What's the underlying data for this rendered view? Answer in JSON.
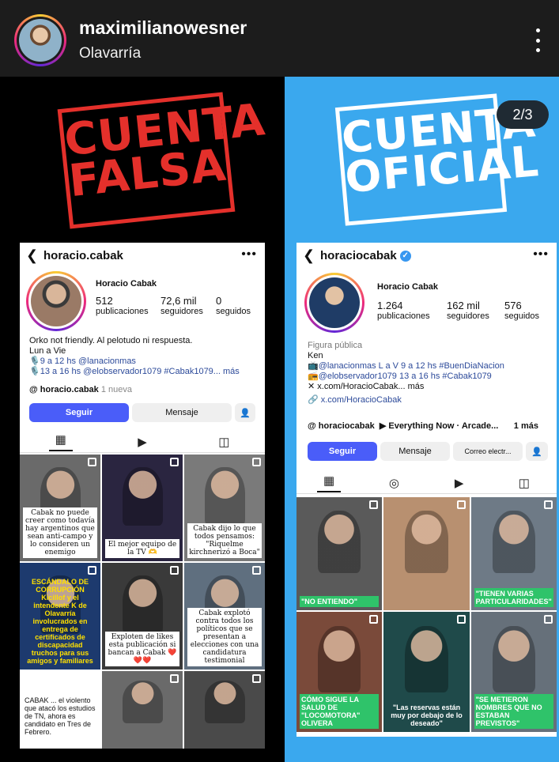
{
  "header": {
    "username": "maximilianowesner",
    "location": "Olavarría"
  },
  "left": {
    "stamp": [
      "CUENTA",
      "FALSA"
    ],
    "profile": {
      "handle": "horacio.cabak",
      "full_name": "Horacio Cabak",
      "stats": [
        {
          "num": "512",
          "label": "publicaciones"
        },
        {
          "num": "72,6 mil",
          "label": "seguidores"
        },
        {
          "num": "0",
          "label": "seguidos"
        }
      ],
      "bio_lines": [
        "Orko not friendly. Al pelotudo ni respuesta.",
        "Lun a Vie",
        "🎙️9 a 12 hs @lanacionmas",
        "🎙️13 a 16 hs @elobservador1079 #Cabak1079... más"
      ],
      "threads_line": "horacio.cabak",
      "threads_badge": "1 nueva",
      "follow_label": "Seguir",
      "message_label": "Mensaje"
    },
    "posts": [
      {
        "caption": "Cabak no puede creer como todavía hay argentinos que sean anti-campo y lo consideren un enemigo",
        "style": "white",
        "bg": "#6a6a6a"
      },
      {
        "caption": "El mejor equipo de la TV 🫶",
        "style": "white",
        "bg": "#2a2540"
      },
      {
        "caption": "Cabak dijo lo que todos pensamos: \"Riquelme kirchnerizó a Boca\"",
        "style": "white",
        "bg": "#7a7a7a"
      },
      {
        "caption": "ESCÁNDALO DE CORRUPCIÓN Kicillof y el intendente K de Olavarría involucrados en entrega de certificados de discapacidad truchos para sus amigos y familiares",
        "style": "yellow",
        "bg": "#1d3a6e"
      },
      {
        "caption": "Exploten de likes esta publicación si bancan a Cabak ❤️❤️❤️",
        "style": "white",
        "bg": "#3a3a3a"
      },
      {
        "caption": "Cabak explotó contra todos los políticos que se presentan a elecciones con una candidatura testimonial",
        "style": "white",
        "bg": "#5f6f7f"
      },
      {
        "caption": "CABAK ... el violento que atacó los estudios de TN, ahora es candidato en Tres de Febrero.",
        "style": "tweet",
        "bg": "#ffffff"
      },
      {
        "caption": "",
        "style": "none",
        "bg": "#6a6a6a"
      },
      {
        "caption": "",
        "style": "none",
        "bg": "#4a4a4a"
      }
    ]
  },
  "right": {
    "stamp": [
      "CUENTA",
      "OFICIAL"
    ],
    "page_indicator": "2/3",
    "profile": {
      "handle": "horaciocabak",
      "full_name": "Horacio Cabak",
      "stats": [
        {
          "num": "1.264",
          "label": "publicaciones"
        },
        {
          "num": "162 mil",
          "label": "seguidores"
        },
        {
          "num": "576",
          "label": "seguidos"
        }
      ],
      "category": "Figura pública",
      "bio_lines": [
        "Ken",
        "📺@lanacionmas L a V 9 a 12 hs #BuenDiaNacion",
        "📻@elobservador1079 13 a 16 hs #Cabak1079",
        "✕ x.com/HoracioCabak... más",
        "🔗 x.com/HoracioCabak"
      ],
      "threads_line": "horaciocabak",
      "music": "Everything Now · Arcade...",
      "more": "1 más",
      "follow_label": "Seguir",
      "message_label": "Mensaje",
      "email_label": "Correo electr..."
    },
    "posts": [
      {
        "caption": "\"NO ENTIENDO\"",
        "style": "green",
        "bg": "#5a5a5a"
      },
      {
        "caption": "",
        "style": "none",
        "bg": "#b89070"
      },
      {
        "caption": "\"TIENEN VARIAS PARTICULARIDADES\"",
        "style": "green",
        "bg": "#6e7a86"
      },
      {
        "caption": "CÓMO SIGUE LA SALUD DE \"LOCOMOTORA\" OLIVERA",
        "style": "green",
        "bg": "#7a4a3a"
      },
      {
        "caption": "\"Las reservas están muy por debajo de lo deseado\"",
        "style": "dark",
        "bg": "#1f4a4a"
      },
      {
        "caption": "\"SE METIERON NOMBRES QUE NO ESTABAN PREVISTOS\"",
        "style": "green",
        "bg": "#66707a"
      }
    ]
  }
}
